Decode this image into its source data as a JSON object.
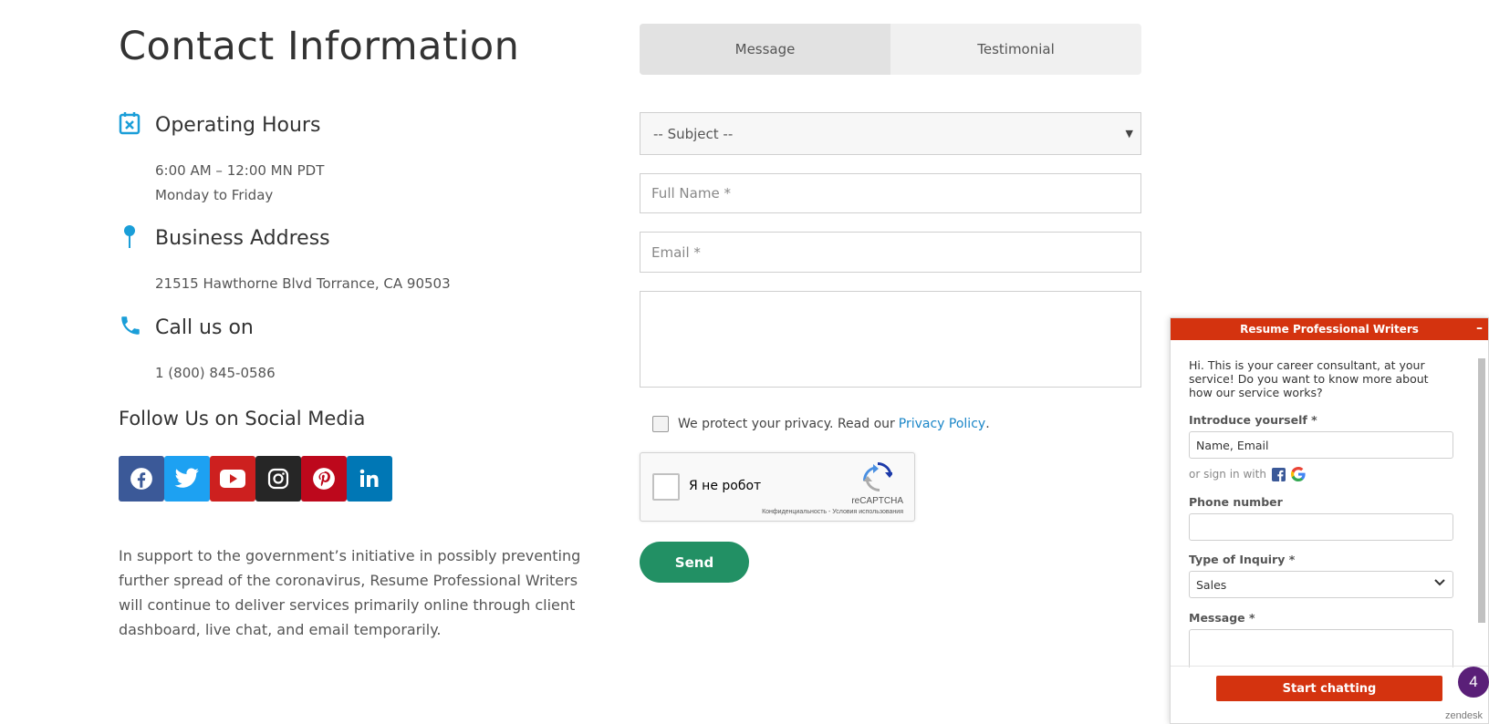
{
  "contact": {
    "title": "Contact Information",
    "hours": {
      "heading": "Operating Hours",
      "line1": "6:00 AM – 12:00 MN PDT",
      "line2": "Monday to Friday"
    },
    "address": {
      "heading": "Business Address",
      "line": "21515 Hawthorne Blvd Torrance, CA 90503"
    },
    "phone": {
      "heading": "Call us on",
      "line": "1 (800) 845-0586"
    },
    "social_heading": "Follow Us on Social Media",
    "socials": [
      {
        "name": "facebook-icon",
        "color": "#3b5998"
      },
      {
        "name": "twitter-icon",
        "color": "#1da1f2"
      },
      {
        "name": "youtube-icon",
        "color": "#cd201f"
      },
      {
        "name": "instagram-icon",
        "color": "#262626"
      },
      {
        "name": "pinterest-icon",
        "color": "#bd081c"
      },
      {
        "name": "linkedin-icon",
        "color": "#0077b5"
      }
    ],
    "notice": "In support to the government’s initiative in possibly preventing further spread of the coronavirus, Resume Professional Writers will continue to deliver services primarily online through client dashboard, live chat, and email temporarily."
  },
  "form": {
    "tabs": [
      "Message",
      "Testimonial"
    ],
    "subject": "-- Subject --",
    "full_name_placeholder": "Full Name *",
    "email_placeholder": "Email *",
    "privacy_text": "We protect your privacy. Read our ",
    "privacy_link": "Privacy Policy",
    "privacy_end": ".",
    "captcha_label": "Я не робот",
    "captcha_brand": "reCAPTCHA",
    "captcha_terms": "Конфиденциальность - Условия использования",
    "send": "Send"
  },
  "chat": {
    "title": "Resume Professional Writers",
    "minimize": "–",
    "intro": "Hi. This is your career consultant, at your service! Do you want to know more about how our service works?",
    "introduce_label": "Introduce yourself *",
    "introduce_value": "Name, Email",
    "sign_in_with": "or sign in with",
    "phone_label": "Phone number",
    "inquiry_label": "Type of Inquiry *",
    "inquiry_value": "Sales",
    "message_label": "Message *",
    "start": "Start chatting",
    "brand": "zendesk",
    "badge_count": "4"
  },
  "colors": {
    "accent": "#1a9ed8",
    "send": "#229064",
    "chat": "#d4330f",
    "badge": "#5a1f78"
  }
}
